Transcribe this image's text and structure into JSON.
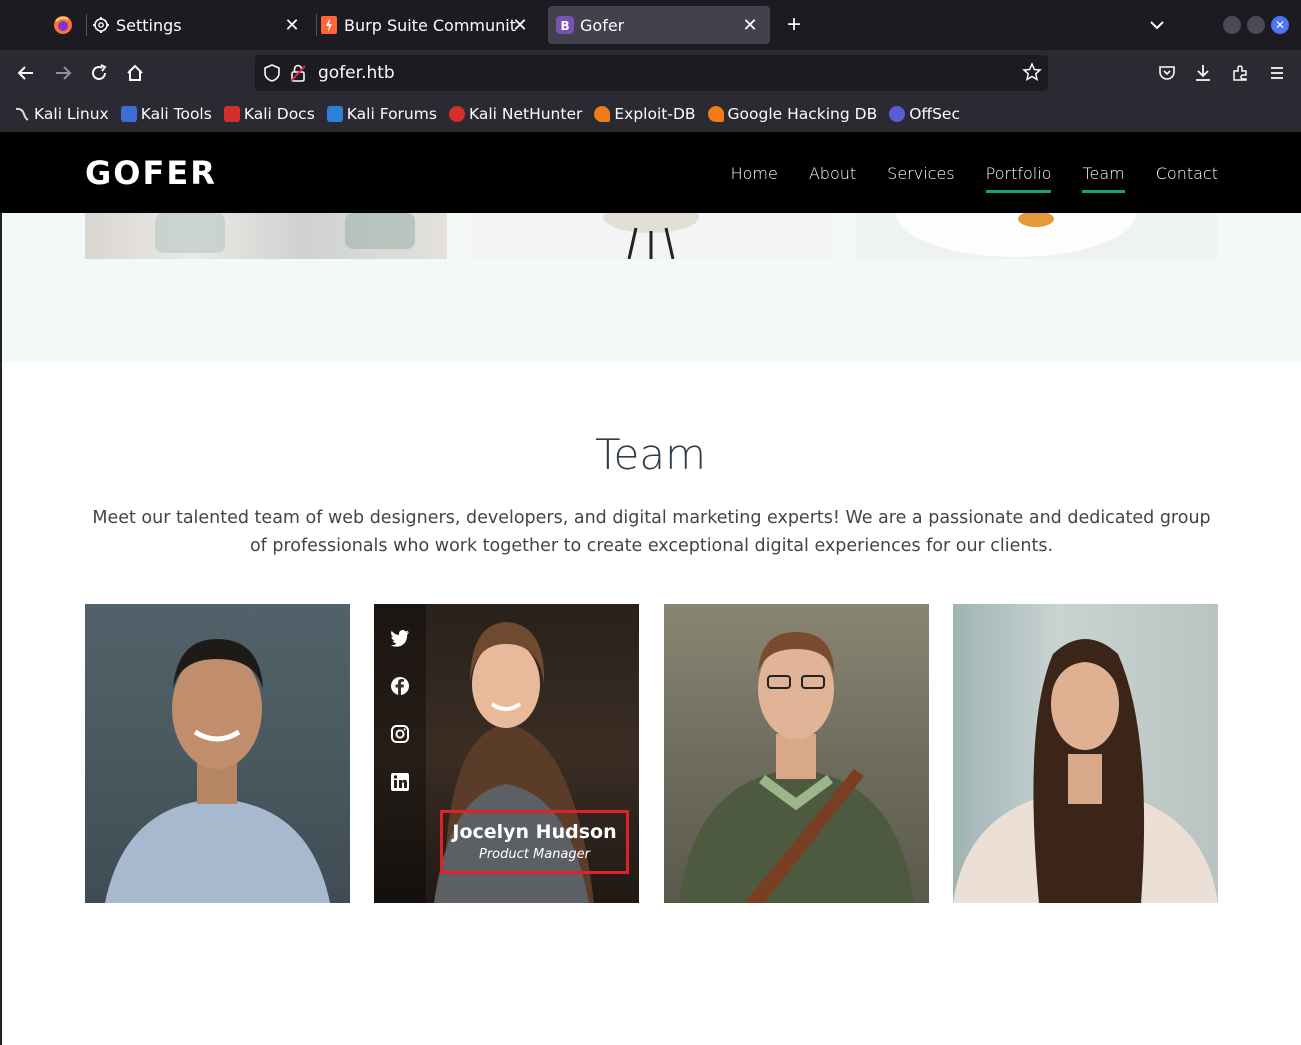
{
  "browser": {
    "tabs": [
      {
        "label": "Settings",
        "icon": "gear-icon"
      },
      {
        "label": "Burp Suite Community Ed",
        "icon": "burp-icon"
      },
      {
        "label": "Gofer",
        "icon": "bootstrap-icon",
        "active": true
      }
    ],
    "url": "gofer.htb",
    "bookmarks": [
      {
        "label": "Kali Linux",
        "color": "#2a2a2a"
      },
      {
        "label": "Kali Tools",
        "color": "#3b6fd6"
      },
      {
        "label": "Kali Docs",
        "color": "#d32f2f"
      },
      {
        "label": "Kali Forums",
        "color": "#2d7fd8"
      },
      {
        "label": "Kali NetHunter",
        "color": "#d32f2f"
      },
      {
        "label": "Exploit-DB",
        "color": "#f07b1b"
      },
      {
        "label": "Google Hacking DB",
        "color": "#f07b1b"
      },
      {
        "label": "OffSec",
        "color": "#5b5bd6"
      }
    ]
  },
  "site": {
    "logo": "GOFER",
    "nav": [
      {
        "label": "Home"
      },
      {
        "label": "About"
      },
      {
        "label": "Services"
      },
      {
        "label": "Portfolio",
        "active": true
      },
      {
        "label": "Team",
        "active": true
      },
      {
        "label": "Contact"
      }
    ],
    "accent": "#18a180",
    "team": {
      "title": "Team",
      "description": "Meet our talented team of web designers, developers, and digital marketing experts! We are a passionate and dedicated group of professionals who work together to create exceptional digital experiences for our clients.",
      "highlighted_member": {
        "name": "Jocelyn Hudson",
        "role": "Product Manager"
      },
      "social_icons": [
        "twitter-icon",
        "facebook-icon",
        "instagram-icon",
        "linkedin-icon"
      ]
    }
  }
}
